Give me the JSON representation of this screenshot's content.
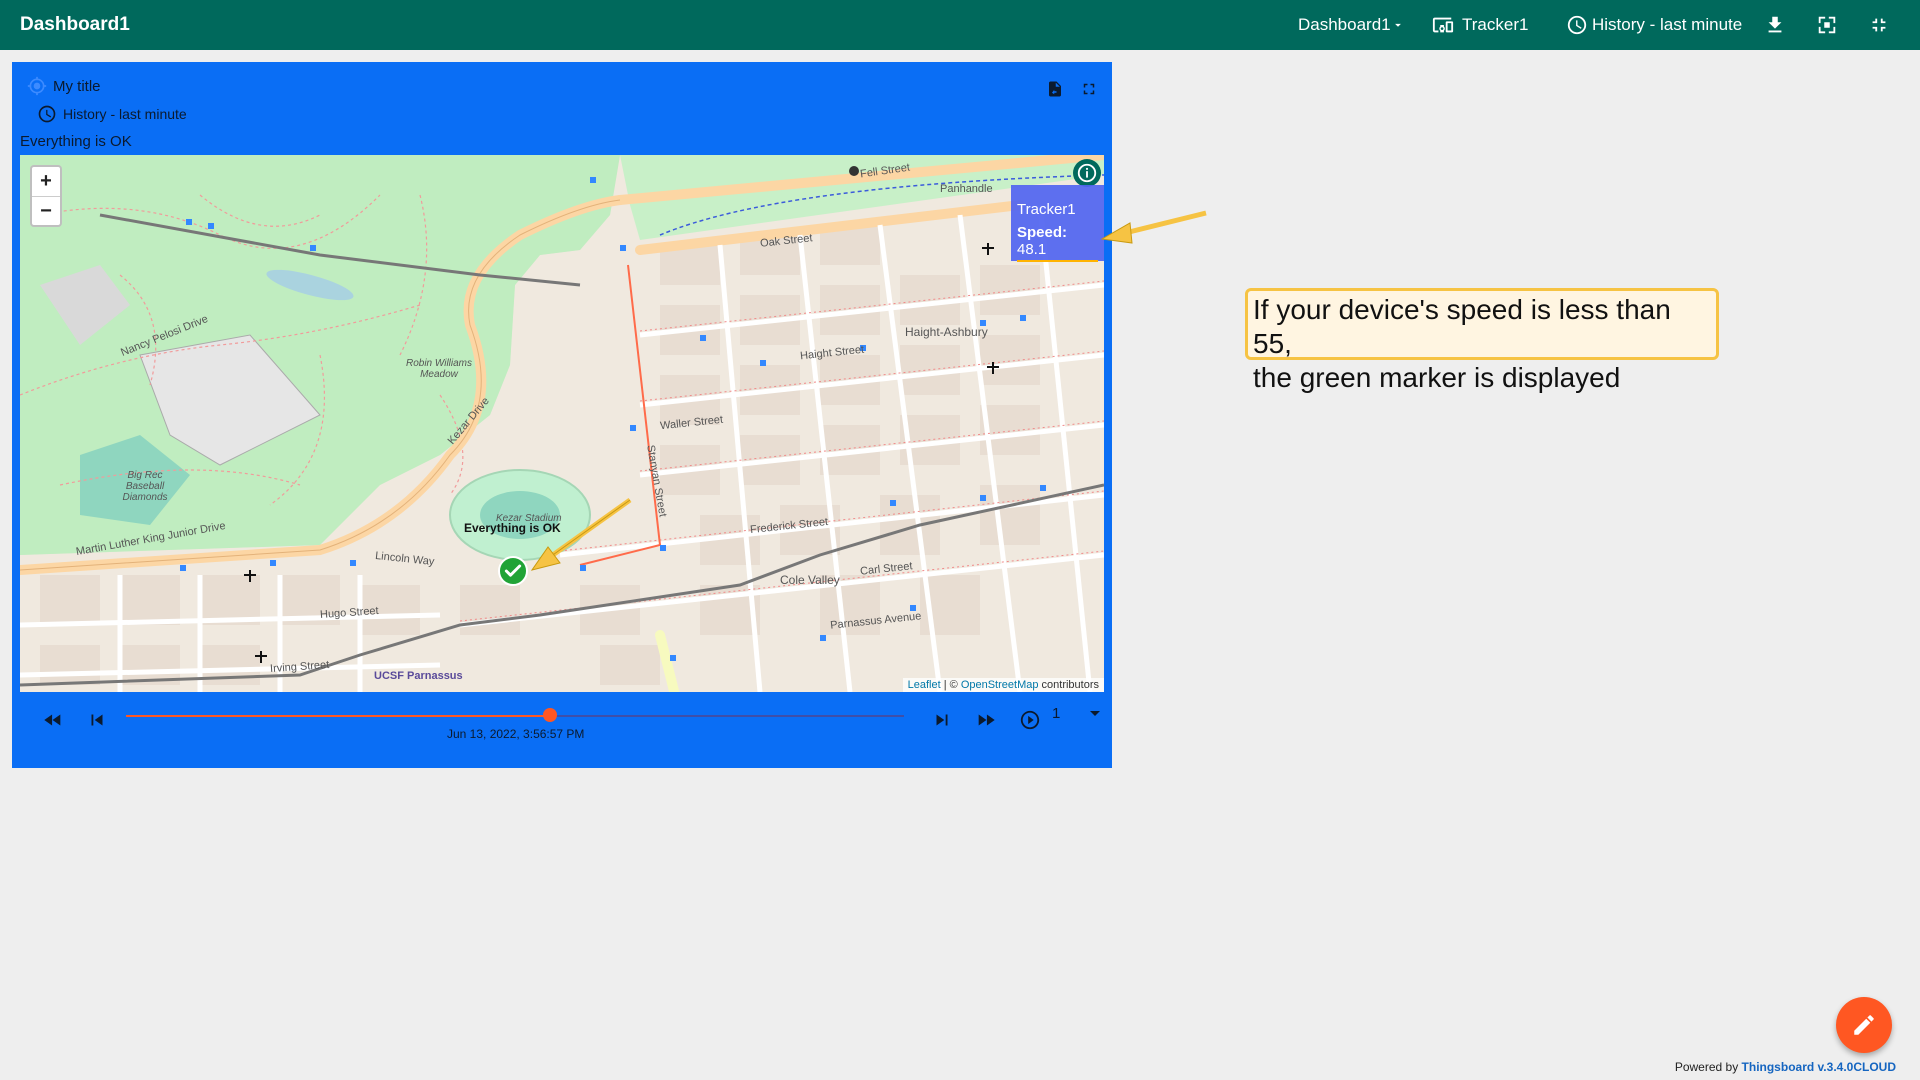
{
  "header": {
    "title": "Dashboard1",
    "dashboard_select": "Dashboard1",
    "entity_label": "Tracker1",
    "timewindow_label": "History - last minute"
  },
  "widget": {
    "title": "My title",
    "timewindow": "History - last minute",
    "status": "Everything is OK"
  },
  "map": {
    "zoom_in": "+",
    "zoom_out": "−",
    "tooltip_name": "Tracker1",
    "tooltip_speed_label": "Speed:",
    "tooltip_speed_value": "48.1",
    "marker_label": "Everything is OK",
    "attribution_leaflet": "Leaflet",
    "attribution_sep": " | © ",
    "attribution_osm": "OpenStreetMap",
    "attribution_suffix": " contributors",
    "labels": {
      "fell_street": "Fell Street",
      "oak_street": "Oak Street",
      "haight_street": "Haight Street",
      "waller_street": "Waller Street",
      "frederick_street": "Frederick Street",
      "carl_street": "Carl Street",
      "parnassus_avenue": "Parnassus Avenue",
      "lincoln_way": "Lincoln Way",
      "kezar_drive": "Kezar Drive",
      "stanyan_street": "Stanyan Street",
      "haight_ashbury": "Haight-Ashbury",
      "panhandle": "Panhandle",
      "kezar_stadium": "Kezar Stadium",
      "cole_valley": "Cole Valley",
      "ucsf_parnassus": "UCSF Parnassus",
      "big_rec": "Big Rec Baseball Diamonds",
      "robin_williams": "Robin Williams Meadow",
      "mlk_drive": "Martin Luther King Junior Drive",
      "nancy_pelosi": "Nancy Pelosi Drive",
      "hugo_street": "Hugo Street",
      "irving_street": "Irving Street"
    }
  },
  "timeline": {
    "timestamp": "Jun 13, 2022, 3:56:57 PM",
    "speed_multiplier": "1",
    "progress": 0.545
  },
  "callout": {
    "line1": "If your device's speed is less than 55,",
    "line2": "the green marker is displayed"
  },
  "footer": {
    "prefix": "Powered by ",
    "brand": "Thingsboard v.3.4.0CLOUD"
  },
  "colors": {
    "header_bg": "#00695c",
    "widget_bg": "#0a6ef5",
    "marker_green": "#21a336",
    "accent_orange": "#ff5722",
    "callout_border": "#f6c343"
  }
}
